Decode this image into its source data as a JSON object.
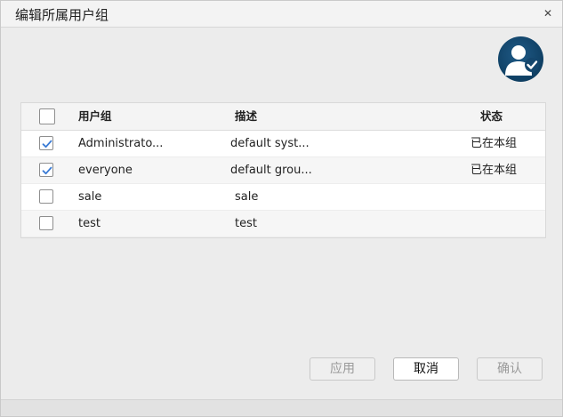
{
  "dialog": {
    "title": "编辑所属用户组",
    "close_icon": "close-icon",
    "avatar_icon": "user-check-icon"
  },
  "table": {
    "headers": {
      "group": "用户组",
      "description": "描述",
      "status": "状态"
    },
    "rows": [
      {
        "checked": true,
        "group": "Administrato...",
        "description": "default syst...",
        "status": "已在本组"
      },
      {
        "checked": true,
        "group": "everyone",
        "description": "default grou...",
        "status": "已在本组"
      },
      {
        "checked": false,
        "group": "sale",
        "description": "sale",
        "status": ""
      },
      {
        "checked": false,
        "group": "test",
        "description": "test",
        "status": ""
      }
    ]
  },
  "buttons": {
    "apply": "应用",
    "cancel": "取消",
    "confirm": "确认"
  },
  "colors": {
    "accent": "#3a7bd5",
    "avatar_bg": "#14466d"
  }
}
